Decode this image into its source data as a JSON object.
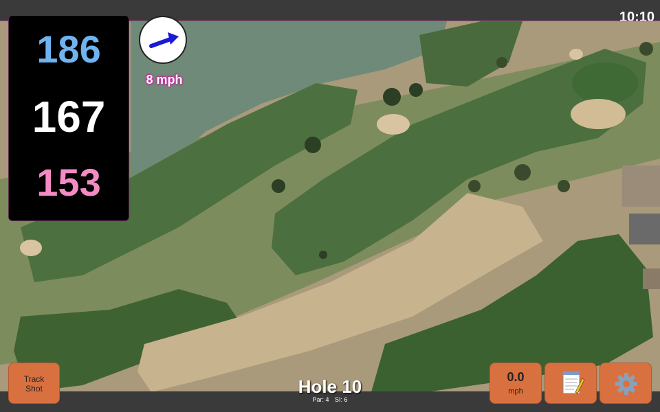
{
  "status": {
    "time": "10:10"
  },
  "yardages": {
    "back": "186",
    "middle": "167",
    "front": "153"
  },
  "wind": {
    "speed": "8 mph",
    "direction_icon": "wind-arrow-icon"
  },
  "buttons": {
    "track_shot_line1": "Track",
    "track_shot_line2": "Shot",
    "speed_value": "0.0",
    "speed_unit": "mph",
    "notes_icon": "notepad-icon",
    "settings_icon": "gear-icon"
  },
  "hole": {
    "title": "Hole 10",
    "par": "Par: 4",
    "stroke_index": "SI: 6"
  },
  "colors": {
    "back": "#6fb4f0",
    "middle": "#ffffff",
    "front": "#f48bc4",
    "button": "#d9703f"
  }
}
